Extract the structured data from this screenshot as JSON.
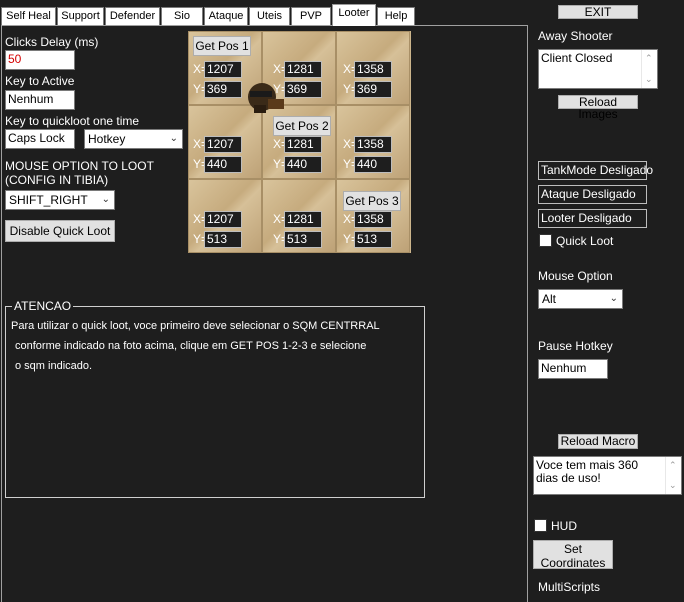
{
  "tabs": [
    {
      "label": "Self Heal"
    },
    {
      "label": "Support"
    },
    {
      "label": "Defender"
    },
    {
      "label": "Sio"
    },
    {
      "label": "Ataque"
    },
    {
      "label": "Uteis"
    },
    {
      "label": "PVP"
    },
    {
      "label": "Looter"
    },
    {
      "label": "Help"
    }
  ],
  "active_tab": "Looter",
  "looter": {
    "clicks_delay_label": "Clicks Delay (ms)",
    "clicks_delay_value": "50",
    "key_active_label": "Key to Active",
    "key_active_value": "Nenhum",
    "quickloot_label": "Key to quickloot one time",
    "quickloot_key_value": "Caps Lock",
    "quickloot_mode_value": "Hotkey",
    "mouse_option_label_line1": "MOUSE OPTION TO LOOT",
    "mouse_option_label_line2": "(CONFIG IN TIBIA)",
    "mouse_option_value": "SHIFT_RIGHT",
    "disable_button": "Disable Quick Loot",
    "get_pos_1": "Get Pos 1",
    "get_pos_2": "Get Pos 2",
    "get_pos_3": "Get Pos 3",
    "x_label": "X=",
    "y_label": "Y=",
    "coords": {
      "r1": {
        "x": [
          "1207",
          "1281",
          "1358"
        ],
        "y": [
          "369",
          "369",
          "369"
        ]
      },
      "r2": {
        "x": [
          "1207",
          "1281",
          "1358"
        ],
        "y": [
          "440",
          "440",
          "440"
        ]
      },
      "r3": {
        "x": [
          "1207",
          "1281",
          "1358"
        ],
        "y": [
          "513",
          "513",
          "513"
        ]
      }
    },
    "notice_title": "ATENCAO",
    "notice_line1": "Para utilizar o quick loot, voce primeiro deve selecionar o SQM CENTRRAL",
    "notice_line2": "conforme indicado na foto acima, clique em GET POS 1-2-3 e selecione",
    "notice_line3": "o sqm indicado."
  },
  "sidebar": {
    "exit_label": "EXIT",
    "away_shooter_label": "Away Shooter",
    "client_status": "Client Closed",
    "reload_images": "Reload Images",
    "tankmode": "TankMode Desligado",
    "ataque": "Ataque Desligado",
    "looter": "Looter Desligado",
    "quick_loot_label": "Quick Loot",
    "mouse_option_label": "Mouse Option",
    "mouse_option_value": "Alt",
    "pause_hotkey_label": "Pause Hotkey",
    "pause_hotkey_value": "Nenhum",
    "reload_macro": "Reload Macro",
    "days_message": "Voce tem mais 360 dias de uso!",
    "hud_label": "HUD",
    "set_coordinates_line1": "Set",
    "set_coordinates_line2": "Coordinates",
    "multiscripts_label": "MultiScripts"
  }
}
